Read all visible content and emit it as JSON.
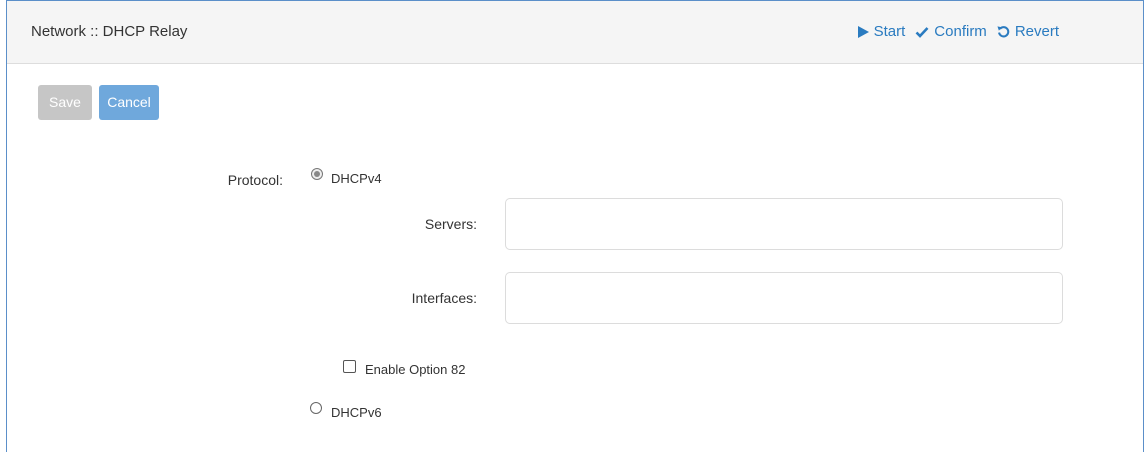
{
  "header": {
    "title": "Network :: DHCP Relay",
    "actions": [
      {
        "label": "Start",
        "icon": "play-icon"
      },
      {
        "label": "Confirm",
        "icon": "check-icon"
      },
      {
        "label": "Revert",
        "icon": "revert-icon"
      }
    ]
  },
  "toolbar": {
    "save_label": "Save",
    "cancel_label": "Cancel"
  },
  "form": {
    "protocol_label": "Protocol:",
    "dhcpv4": {
      "label": "DHCPv4",
      "selected": true
    },
    "servers": {
      "label": "Servers:",
      "value": "",
      "placeholder": ""
    },
    "interfaces": {
      "label": "Interfaces:",
      "value": "",
      "placeholder": ""
    },
    "option82": {
      "label": "Enable Option 82",
      "checked": false
    },
    "dhcpv6": {
      "label": "DHCPv6",
      "selected": false
    }
  },
  "colors": {
    "accent": "#2a7bc0",
    "frame_border": "#5b8fc9",
    "save_disabled": "#c6c6c6",
    "cancel": "#6fa8dc"
  }
}
